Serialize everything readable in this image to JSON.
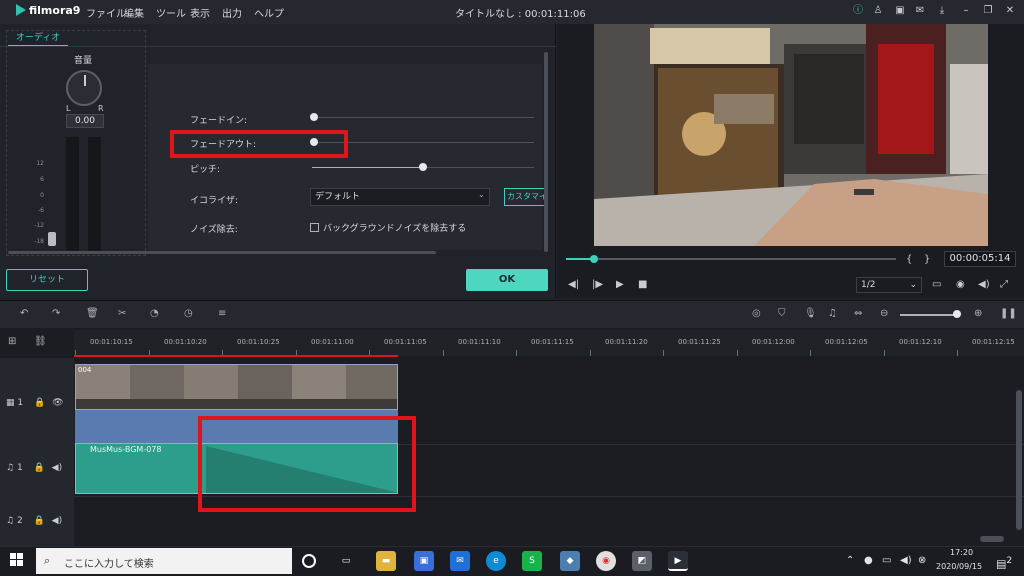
{
  "app": {
    "logo": "filmora9",
    "menus": [
      "ファイル",
      "編集",
      "ツール",
      "表示",
      "出力",
      "ヘルプ"
    ],
    "title": "タイトルなし : 00:01:11:06"
  },
  "audio_panel": {
    "tab": "オーディオ",
    "volume_label": "音量",
    "knob_left": "L",
    "knob_right": "R",
    "volume_value": "0.00",
    "db_ticks": [
      "12",
      "6",
      "0",
      "-6",
      "-12",
      "-18"
    ],
    "settings": {
      "fade_in_label": "フェードイン:",
      "fade_in_value": 0,
      "fade_out_label": "フェードアウト:",
      "fade_out_value": 0,
      "pitch_label": "ピッチ:",
      "pitch_value": 0.5,
      "equalizer_label": "イコライザ:",
      "equalizer_value": "デフォルト",
      "custom_button": "カスタマイ",
      "noise_label": "ノイズ除去:",
      "noise_checkbox": "バックグラウンドノイズを除去する"
    },
    "reset_button": "リセット",
    "ok_button": "OK"
  },
  "preview": {
    "timecode": "00:00:05:14",
    "ratio": "1/2",
    "progress": 0.08
  },
  "timeline": {
    "ruler": [
      "00:01:10:15",
      "00:01:10:20",
      "00:01:10:25",
      "00:01:11:00",
      "00:01:11:05",
      "00:01:11:10",
      "00:01:11:15",
      "00:01:11:20",
      "00:01:11:25",
      "00:01:12:00",
      "00:01:12:05",
      "00:01:12:10",
      "00:01:12:15"
    ],
    "track_video_label": "1",
    "track_audio1_label": "1",
    "track_audio2_label": "2",
    "video_clip_name": "004",
    "audio_clip_name": "MusMus-BGM-078"
  },
  "taskbar": {
    "search_placeholder": "ここに入力して検索",
    "time": "17:20",
    "date": "2020/09/15",
    "notification_count": "2"
  }
}
